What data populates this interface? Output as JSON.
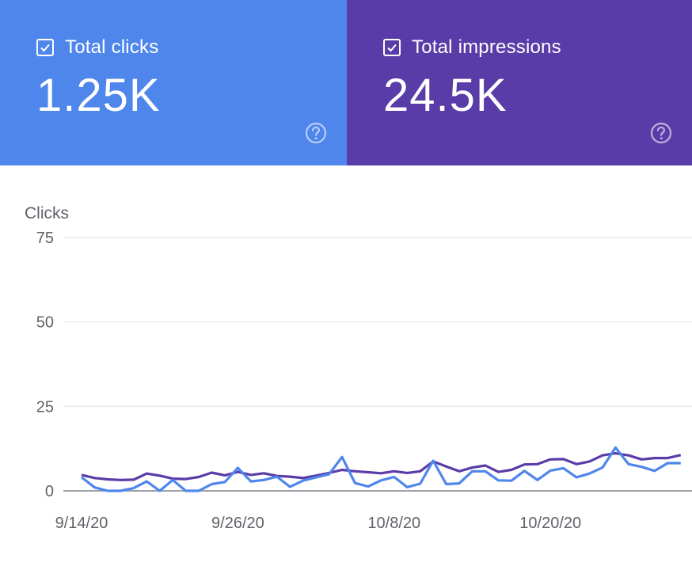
{
  "cards": {
    "clicks": {
      "label": "Total clicks",
      "value": "1.25K",
      "color": "#4f86eb",
      "checked": true
    },
    "impressions": {
      "label": "Total impressions",
      "value": "24.5K",
      "color": "#5a3ca8",
      "checked": true
    }
  },
  "icons": {
    "checkbox": "check-icon",
    "help": "help-circle-icon"
  },
  "chart_data": {
    "type": "line",
    "ylabel": "Clicks",
    "ylim": [
      0,
      75
    ],
    "yticks": [
      0,
      25,
      50,
      75
    ],
    "xtick_labels": [
      "9/14/20",
      "9/26/20",
      "10/8/20",
      "10/20/20"
    ],
    "xtick_index": [
      0,
      12,
      24,
      36
    ],
    "x": [
      "9/14/20",
      "9/15/20",
      "9/16/20",
      "9/17/20",
      "9/18/20",
      "9/19/20",
      "9/20/20",
      "9/21/20",
      "9/22/20",
      "9/23/20",
      "9/24/20",
      "9/25/20",
      "9/26/20",
      "9/27/20",
      "9/28/20",
      "9/29/20",
      "9/30/20",
      "10/1/20",
      "10/2/20",
      "10/3/20",
      "10/4/20",
      "10/5/20",
      "10/6/20",
      "10/7/20",
      "10/8/20",
      "10/9/20",
      "10/10/20",
      "10/11/20",
      "10/12/20",
      "10/13/20",
      "10/14/20",
      "10/15/20",
      "10/16/20",
      "10/17/20",
      "10/18/20",
      "10/19/20",
      "10/20/20",
      "10/21/20",
      "10/22/20",
      "10/23/20",
      "10/24/20",
      "10/25/20",
      "10/26/20",
      "10/27/20",
      "10/28/20",
      "10/29/20",
      "10/30/20"
    ],
    "grid": true,
    "series": [
      {
        "color": "#5a3ca8",
        "values": [
          4.7,
          3.8,
          3.4,
          3.2,
          3.3,
          5.1,
          4.5,
          3.6,
          3.5,
          4.1,
          5.4,
          4.6,
          5.6,
          4.7,
          5.2,
          4.4,
          4.2,
          3.8,
          4.5,
          5.3,
          6.2,
          5.8,
          5.5,
          5.2,
          5.8,
          5.3,
          5.8,
          8.7,
          7.2,
          5.8,
          6.9,
          7.5,
          5.6,
          6.2,
          7.8,
          7.9,
          9.3,
          9.4,
          7.9,
          8.7,
          10.5,
          11.1,
          10.5,
          9.3,
          9.7,
          9.7,
          10.6
        ]
      },
      {
        "color": "#4f86eb",
        "values": [
          4,
          1,
          0,
          0,
          0.8,
          2.8,
          0,
          3.2,
          0,
          0,
          2,
          2.6,
          6.8,
          2.8,
          3.2,
          4.2,
          1.2,
          3,
          4,
          4.9,
          10,
          2.3,
          1.3,
          3.1,
          4.1,
          1.1,
          2.1,
          8.9,
          2,
          2.2,
          5.8,
          5.8,
          3.1,
          3,
          5.9,
          3.2,
          6,
          6.7,
          4,
          5.1,
          6.9,
          12.8,
          7.9,
          7.1,
          5.9,
          8.2,
          8.2
        ]
      }
    ]
  }
}
